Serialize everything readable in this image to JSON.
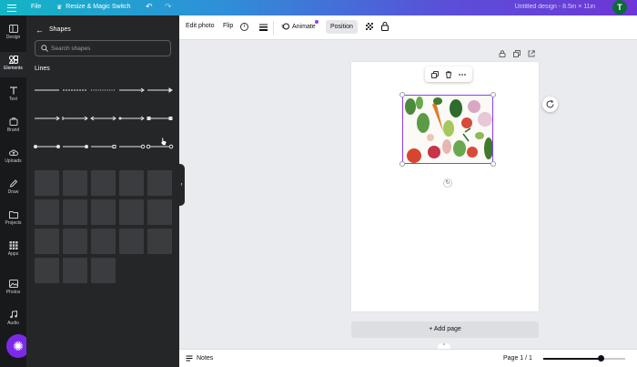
{
  "topbar": {
    "file_label": "File",
    "resize_label": "Resize & Magic Switch",
    "undo_glyph": "↶",
    "redo_glyph": "↷",
    "design_title": "Untitled design - 8.5in × 11in",
    "avatar_initial": "T"
  },
  "rail": {
    "items": [
      {
        "label": "Design",
        "icon": "design-icon"
      },
      {
        "label": "Elements",
        "icon": "elements-icon"
      },
      {
        "label": "Text",
        "icon": "text-icon"
      },
      {
        "label": "Brand",
        "icon": "brand-icon"
      },
      {
        "label": "Uploads",
        "icon": "uploads-icon"
      },
      {
        "label": "Draw",
        "icon": "draw-icon"
      },
      {
        "label": "Projects",
        "icon": "projects-icon"
      },
      {
        "label": "Apps",
        "icon": "apps-icon"
      },
      {
        "label": "Photos",
        "icon": "photos-icon"
      },
      {
        "label": "Audio",
        "icon": "audio-icon"
      }
    ],
    "active_index": 1,
    "magic_glyph": "✺"
  },
  "panel": {
    "title": "Shapes",
    "search_placeholder": "Search shapes",
    "section_label": "Lines"
  },
  "toolbar": {
    "edit_photo": "Edit photo",
    "flip": "Flip",
    "info_glyph": "i",
    "animate": "Animate",
    "position": "Position"
  },
  "canvas": {
    "add_page": "+ Add page",
    "rotate_glyph": "↻"
  },
  "bottombar": {
    "notes": "Notes",
    "page_indicator": "Page 1 / 1",
    "zoom_fraction": 0.7
  },
  "colors": {
    "accent": "#8b3dff",
    "panel_bg": "#252627",
    "rail_bg": "#18191b",
    "magic_fab": "#7d2ae8"
  }
}
